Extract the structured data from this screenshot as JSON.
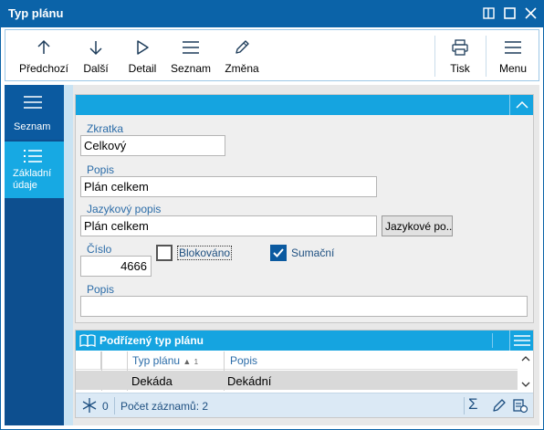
{
  "window": {
    "title": "Typ plánu"
  },
  "toolbar": {
    "prev": "Předchozí",
    "next": "Další",
    "detail": "Detail",
    "list": "Seznam",
    "edit": "Změna",
    "print": "Tisk",
    "menu": "Menu"
  },
  "nav": {
    "list": "Seznam",
    "basic_line1": "Základní",
    "basic_line2": "údaje"
  },
  "form": {
    "abbrev_label": "Zkratka",
    "abbrev_value": "Celkový",
    "name_label": "Popis",
    "name_value": "Plán celkem",
    "lang_label": "Jazykový popis",
    "lang_value": "Plán celkem",
    "lang_button": "Jazykové po...",
    "number_label": "Číslo",
    "number_value": "4666",
    "blocked_label": "Blokováno",
    "blocked_checked": false,
    "summary_label": "Sumační",
    "summary_checked": true,
    "desc_label": "Popis",
    "desc_value": ""
  },
  "subgrid": {
    "title": "Podřízený typ plánu",
    "columns": {
      "type": "Typ plánu",
      "sort_index": "1",
      "desc": "Popis"
    },
    "rows": [
      {
        "type": "Dekáda",
        "desc": "Dekádní"
      }
    ],
    "footer": {
      "selected_count": "0",
      "records": "Počet záznamů: 2"
    }
  },
  "colors": {
    "titlebar": "#0b63a8",
    "nav": "#0d4f8f",
    "nav_active": "#17a9e3",
    "accent": "#15a4e0"
  }
}
